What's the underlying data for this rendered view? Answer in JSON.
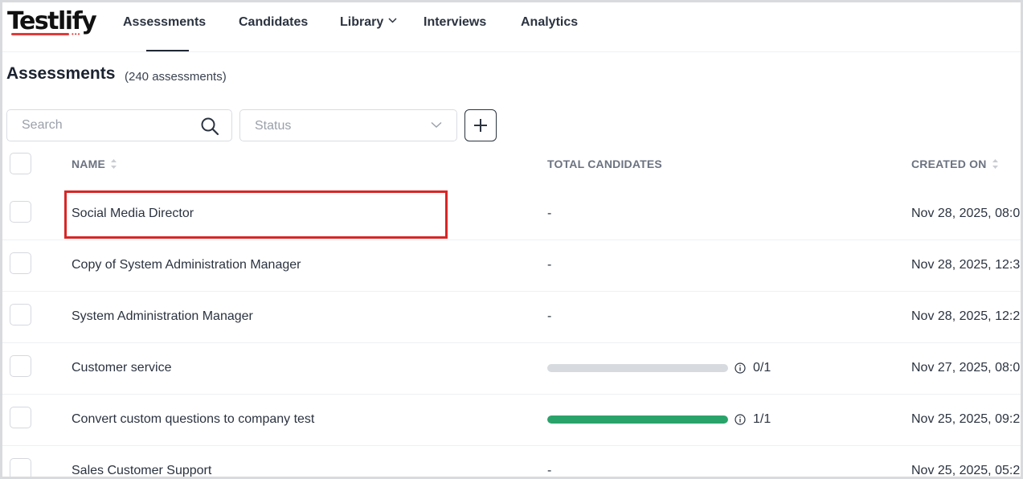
{
  "app": {
    "logo_text": "Testlify",
    "nav": [
      {
        "label": "Assessments",
        "active": true
      },
      {
        "label": "Candidates",
        "active": false
      },
      {
        "label": "Library",
        "active": false,
        "has_dropdown": true
      },
      {
        "label": "Interviews",
        "active": false
      },
      {
        "label": "Analytics",
        "active": false
      }
    ]
  },
  "page": {
    "title": "Assessments",
    "count_text": "(240 assessments)"
  },
  "filters": {
    "search_placeholder": "Search",
    "status_placeholder": "Status"
  },
  "table": {
    "columns": [
      "NAME",
      "TOTAL CANDIDATES",
      "CREATED ON"
    ],
    "rows": [
      {
        "name": "Social Media Director",
        "candidates": "-",
        "created": "Nov 28, 2025, 08:0",
        "highlighted": true
      },
      {
        "name": "Copy of System Administration Manager",
        "candidates": "-",
        "created": "Nov 28, 2025, 12:3"
      },
      {
        "name": "System Administration Manager",
        "candidates": "-",
        "created": "Nov 28, 2025, 12:2"
      },
      {
        "name": "Customer service",
        "candidates": "0/1",
        "progress": 0,
        "created": "Nov 27, 2025, 08:0"
      },
      {
        "name": "Convert custom questions to company test",
        "candidates": "1/1",
        "progress": 1,
        "created": "Nov 25, 2025, 09:2"
      },
      {
        "name": "Sales Customer Support",
        "candidates": "-",
        "created": "Nov 25, 2025, 05:2"
      }
    ]
  },
  "colors": {
    "highlight": "#d92626",
    "progress_fill": "#2aa36a",
    "progress_track": "#d7dadf",
    "logo_accent": "#e23a3a"
  }
}
